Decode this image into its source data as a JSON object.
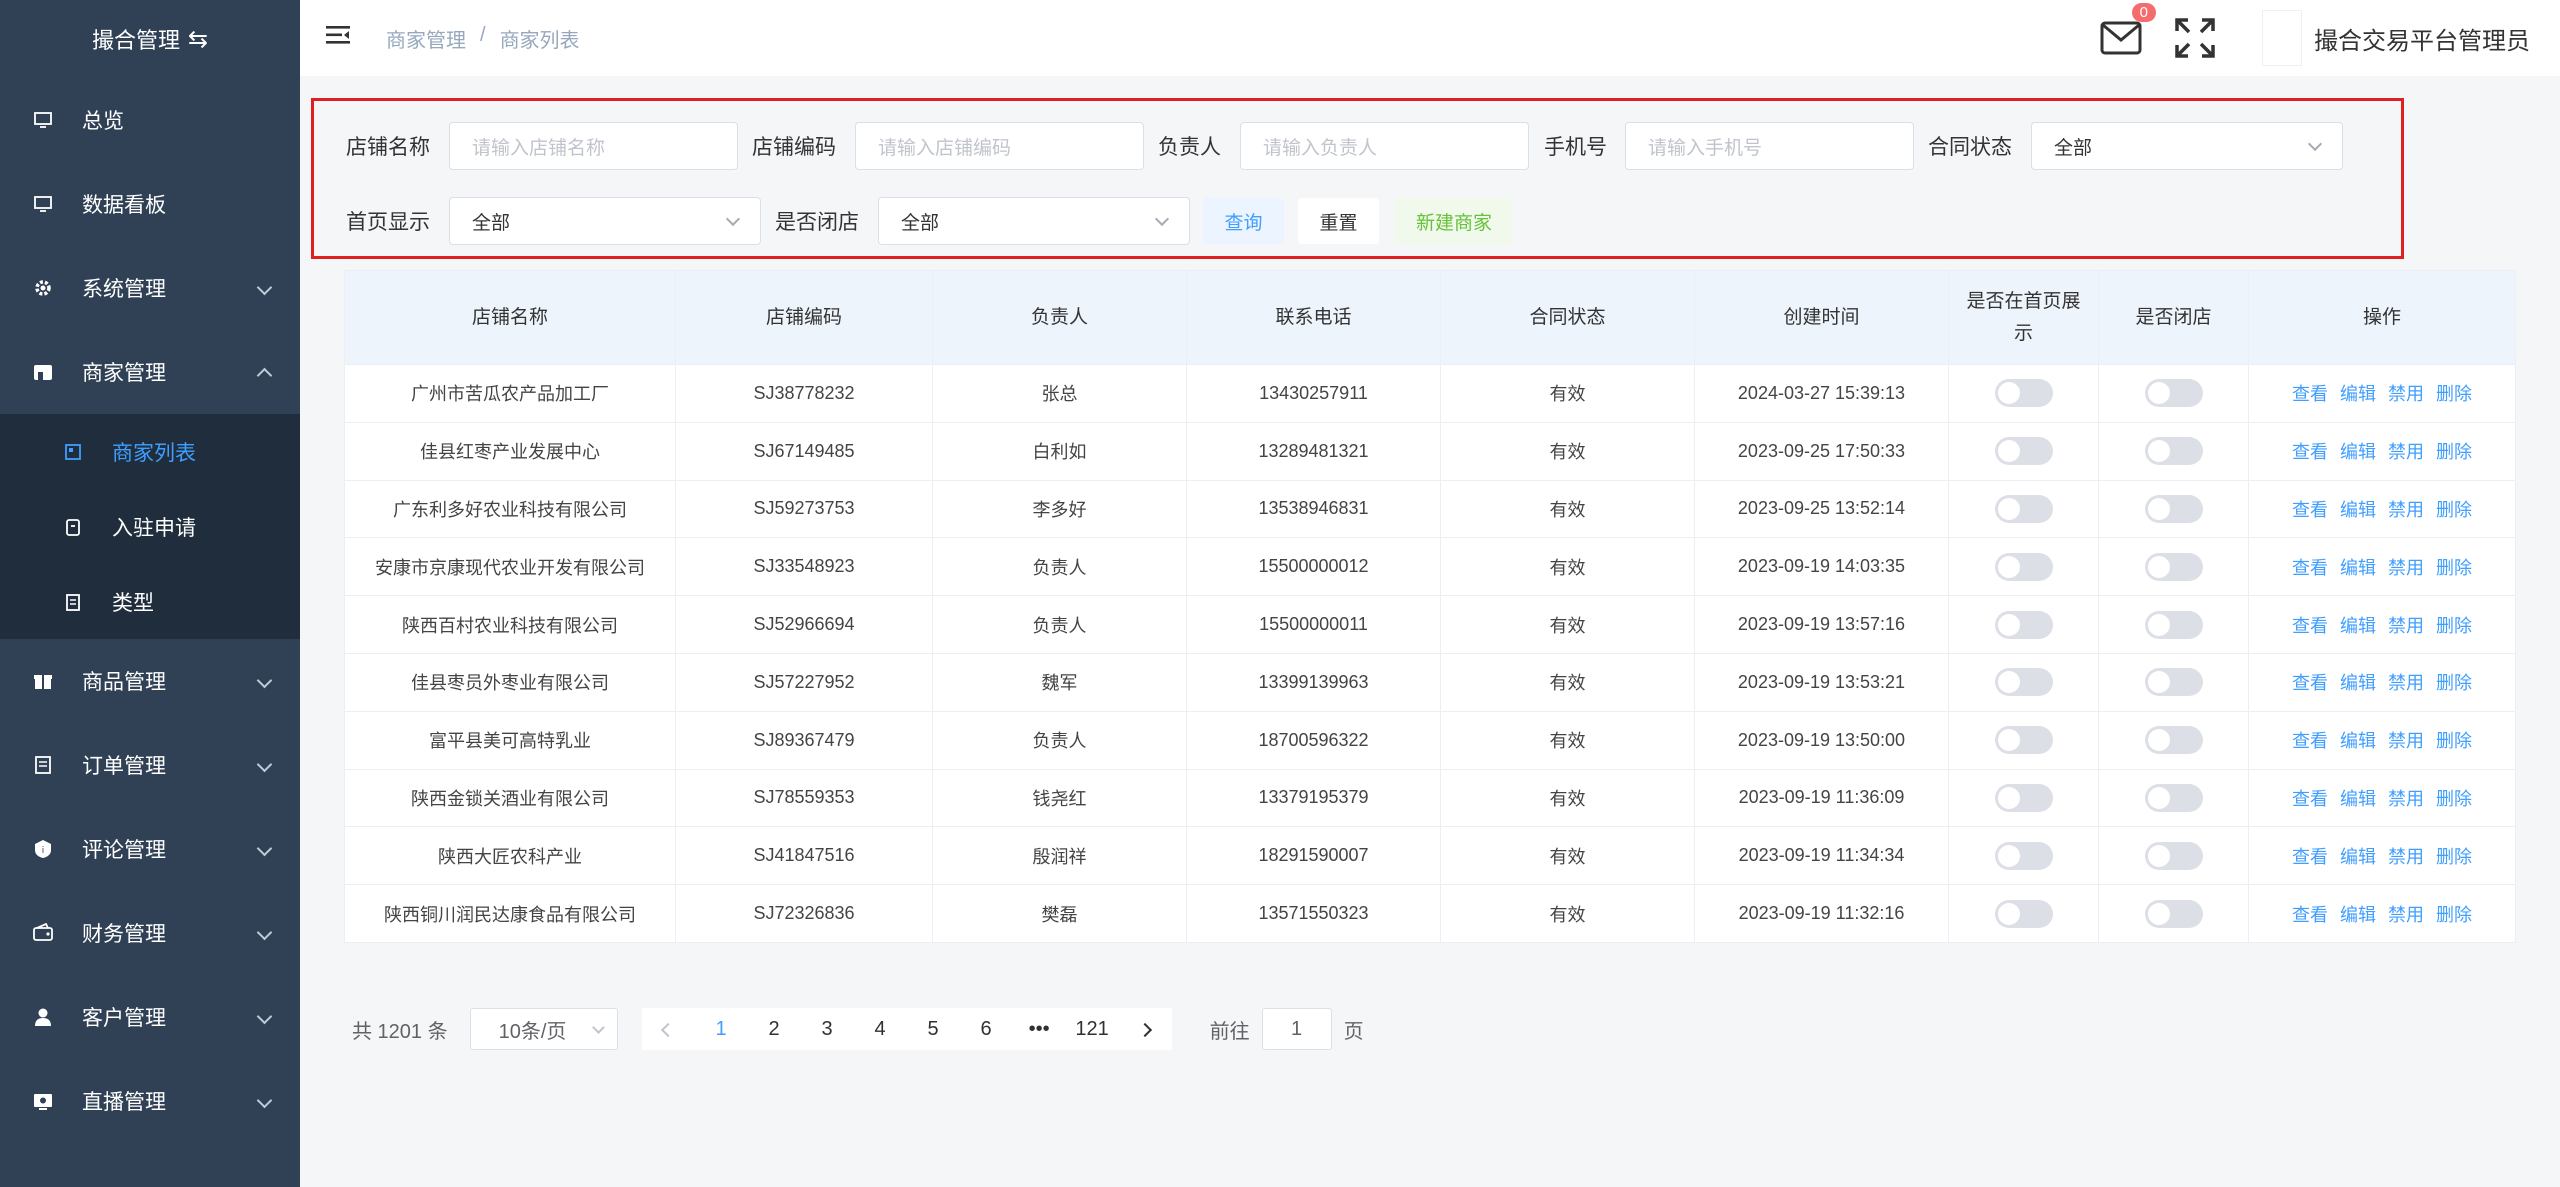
{
  "sidebar": {
    "brand": "撮合管理",
    "items": [
      {
        "label": "总览",
        "icon": "monitor-icon"
      },
      {
        "label": "数据看板",
        "icon": "monitor-icon"
      },
      {
        "label": "系统管理",
        "icon": "gear-icon"
      },
      {
        "label": "商家管理",
        "icon": "store-icon"
      },
      {
        "label": "商品管理",
        "icon": "gift-icon"
      },
      {
        "label": "订单管理",
        "icon": "document-icon"
      },
      {
        "label": "评论管理",
        "icon": "shield-icon"
      },
      {
        "label": "财务管理",
        "icon": "wallet-icon"
      },
      {
        "label": "客户管理",
        "icon": "user-icon"
      },
      {
        "label": "直播管理",
        "icon": "tv-icon"
      }
    ],
    "submenu": [
      {
        "label": "商家列表"
      },
      {
        "label": "入驻申请"
      },
      {
        "label": "类型"
      }
    ]
  },
  "header": {
    "breadcrumb": [
      "商家管理",
      "/",
      "商家列表"
    ],
    "mail_count": "0",
    "username": "撮合交易平台管理员"
  },
  "filter": {
    "shop_name_label": "店铺名称",
    "shop_name_placeholder": "请输入店铺名称",
    "shop_code_label": "店铺编码",
    "shop_code_placeholder": "请输入店铺编码",
    "owner_label": "负责人",
    "owner_placeholder": "请输入负责人",
    "phone_label": "手机号",
    "phone_placeholder": "请输入手机号",
    "contract_label": "合同状态",
    "contract_value": "全部",
    "home_label": "首页显示",
    "home_value": "全部",
    "closed_label": "是否闭店",
    "closed_value": "全部",
    "query": "查询",
    "reset": "重置",
    "new": "新建商家"
  },
  "table": {
    "headers": [
      "店铺名称",
      "店铺编码",
      "负责人",
      "联系电话",
      "合同状态",
      "创建时间",
      "是否在首页展示",
      "是否闭店",
      "操作"
    ],
    "actions": [
      "查看",
      "编辑",
      "禁用",
      "删除"
    ],
    "rows": [
      [
        "广州市苦瓜农产品加工厂",
        "SJ38778232",
        "张总",
        "13430257911",
        "有效",
        "2024-03-27 15:39:13"
      ],
      [
        "佳县红枣产业发展中心",
        "SJ67149485",
        "白利如",
        "13289481321",
        "有效",
        "2023-09-25 17:50:33"
      ],
      [
        "广东利多好农业科技有限公司",
        "SJ59273753",
        "李多好",
        "13538946831",
        "有效",
        "2023-09-25 13:52:14"
      ],
      [
        "安康市京康现代农业开发有限公司",
        "SJ33548923",
        "负责人",
        "15500000012",
        "有效",
        "2023-09-19 14:03:35"
      ],
      [
        "陕西百村农业科技有限公司",
        "SJ52966694",
        "负责人",
        "15500000011",
        "有效",
        "2023-09-19 13:57:16"
      ],
      [
        "佳县枣员外枣业有限公司",
        "SJ57227952",
        "魏军",
        "13399139963",
        "有效",
        "2023-09-19 13:53:21"
      ],
      [
        "富平县美可高特乳业",
        "SJ89367479",
        "负责人",
        "18700596322",
        "有效",
        "2023-09-19 13:50:00"
      ],
      [
        "陕西金锁关酒业有限公司",
        "SJ78559353",
        "钱尧红",
        "13379195379",
        "有效",
        "2023-09-19 11:36:09"
      ],
      [
        "陕西大匠农科产业",
        "SJ41847516",
        "殷润祥",
        "18291590007",
        "有效",
        "2023-09-19 11:34:34"
      ],
      [
        "陕西铜川润民达康食品有限公司",
        "SJ72326836",
        "樊磊",
        "13571550323",
        "有效",
        "2023-09-19 11:32:16"
      ]
    ]
  },
  "pagination": {
    "total": "共 1201 条",
    "page_size": "10条/页",
    "pages": [
      "1",
      "2",
      "3",
      "4",
      "5",
      "6",
      "•••",
      "121"
    ],
    "goto_prefix": "前往",
    "goto_value": "1",
    "goto_suffix": "页"
  }
}
